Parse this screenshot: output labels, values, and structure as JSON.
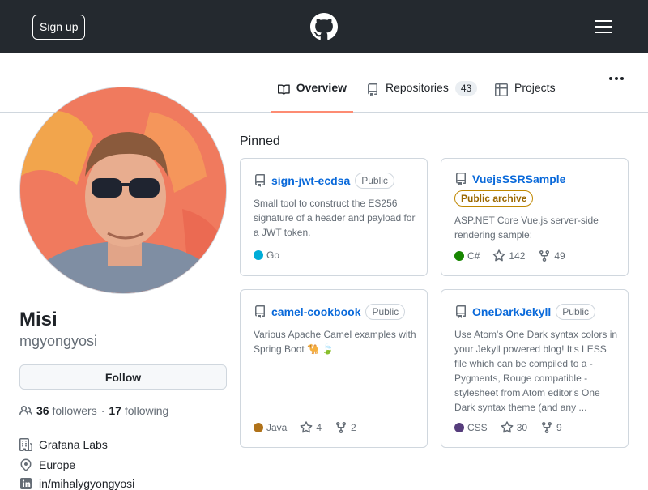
{
  "header": {
    "signup_label": "Sign up"
  },
  "tabs": [
    {
      "label": "Overview"
    },
    {
      "label": "Repositories",
      "count": "43"
    },
    {
      "label": "Projects"
    }
  ],
  "profile": {
    "name": "Misi",
    "login": "mgyongyosi",
    "follow_label": "Follow",
    "followers_count": "36",
    "followers_label": "followers",
    "separator": "·",
    "following_count": "17",
    "following_label": "following",
    "company": "Grafana Labs",
    "location": "Europe",
    "linkedin": "in/mihalygyongyosi"
  },
  "pinned": {
    "title": "Pinned",
    "repos": [
      {
        "name": "sign-jwt-ecdsa",
        "badge": "Public",
        "description": "Small tool to construct the ES256 signature of a header and payload for a JWT token.",
        "language": "Go",
        "language_color": "#00ADD8"
      },
      {
        "name": "VuejsSSRSample",
        "badge": "Public archive",
        "description": "ASP.NET Core Vue.js server-side rendering sample:",
        "language": "C#",
        "language_color": "#178600",
        "stars": "142",
        "forks": "49"
      },
      {
        "name": "camel-cookbook",
        "badge": "Public",
        "description": "Various Apache Camel examples with Spring Boot 🐪 🍃",
        "language": "Java",
        "language_color": "#b07219",
        "stars": "4",
        "forks": "2"
      },
      {
        "name": "OneDarkJekyll",
        "badge": "Public",
        "description": "Use Atom's One Dark syntax colors in your Jekyll powered blog! It's LESS file which can be compiled to a - Pygments, Rouge compatible - stylesheet from Atom editor's One Dark syntax theme (and any ...",
        "language": "CSS",
        "language_color": "#563d7c",
        "stars": "30",
        "forks": "9"
      }
    ]
  },
  "colors": {
    "header_bg": "#24292f",
    "link": "#0969da",
    "tab_underline": "#fd8c73",
    "archive": "#9a6700"
  }
}
